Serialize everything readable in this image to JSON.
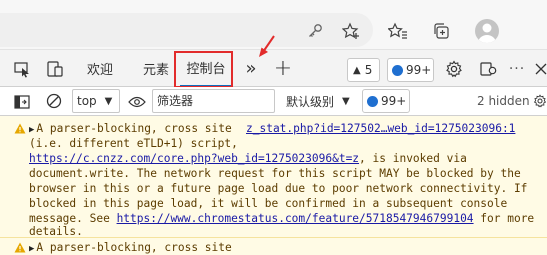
{
  "browser": {
    "icons": [
      "key-icon",
      "add-favorite-icon",
      "favorites-icon",
      "collections-icon",
      "profile-avatar-icon"
    ]
  },
  "devtools": {
    "tabs": [
      {
        "label": "欢迎"
      },
      {
        "label": "元素"
      },
      {
        "label": "控制台"
      }
    ],
    "more_tabs": "»",
    "add_tab": "+",
    "warnings_count": "5",
    "issues_count": "99+"
  },
  "console_bar": {
    "context": "top",
    "filter_placeholder": "筛选器",
    "level": "默认级别",
    "issues_count": "99+",
    "hidden": "2 hidden"
  },
  "message": {
    "line1": "A parser-blocking, cross site",
    "source": "z_stat.php?id=127502…web_id=1275023096:1",
    "line2": "(i.e. different eTLD+1) script,",
    "line3_link": "https://c.cnzz.com/core.php?web_id=1275023096&t=z",
    "line3_rest": ", is invoked via",
    "line4": "document.write. The network request for this script MAY be blocked by the",
    "line5": "browser in this or a future page load due to poor network connectivity. If",
    "line6": "blocked in this page load, it will be confirmed in a subsequent console",
    "line7_pre": "message. See ",
    "line7_link": "https://www.chromestatus.com/feature/5718547946799104",
    "line7_rest": " for more",
    "line8": "details.",
    "next_line": "A parser-blocking, cross site"
  },
  "colors": {
    "accent": "#0f6cbd",
    "highlight": "#e22b2b",
    "warning_bg": "#fffbe5",
    "link": "#1a1aa6"
  }
}
